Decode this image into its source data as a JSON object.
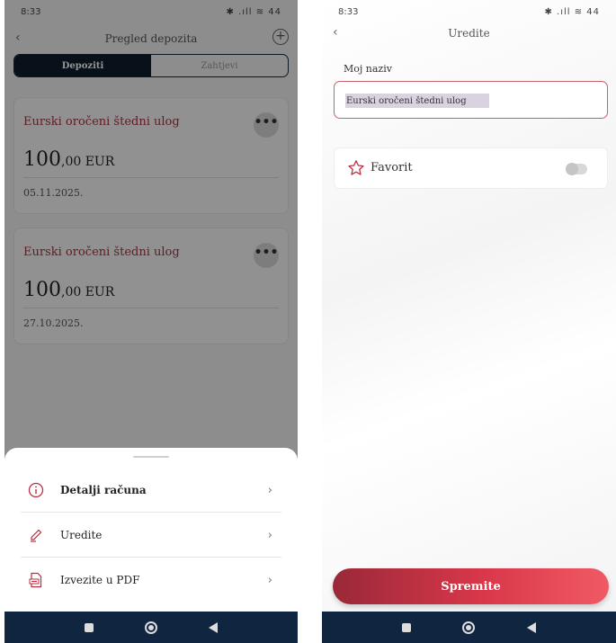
{
  "status_bar": {
    "time": "8:33",
    "indicators": "✦ ▮ ⬆ ▸",
    "right": "✱ .ıll ≋ 44"
  },
  "left_screen": {
    "header": {
      "back_icon": "chevron-left-icon",
      "title": "Pregled depozita",
      "action_icon": "plus-circle-icon"
    },
    "tabs": [
      {
        "label": "Depoziti",
        "active": true
      },
      {
        "label": "Zahtjevi",
        "active": false
      }
    ],
    "deposits": [
      {
        "name": "Eurski oročeni štedni ulog",
        "amount_int": "100",
        "amount_dec": ",00 EUR",
        "date": "05.11.2025."
      },
      {
        "name": "Eurski oročeni štedni ulog",
        "amount_int": "100",
        "amount_dec": ",00 EUR",
        "date": "27.10.2025."
      }
    ],
    "more_label": "•••",
    "sheet": {
      "items": [
        {
          "label": "Detalji računa",
          "icon": "info-icon"
        },
        {
          "label": "Uredite",
          "icon": "pencil-icon"
        },
        {
          "label": "Izvezite u PDF",
          "icon": "pdf-icon"
        }
      ],
      "chevron": "›"
    }
  },
  "right_screen": {
    "header": {
      "back_icon": "chevron-left-icon",
      "title": "Uredite"
    },
    "name_field": {
      "label": "Moj naziv",
      "value": "Eurski oročeni štedni ulog"
    },
    "favorite": {
      "label": "Favorit",
      "icon": "star-icon",
      "enabled": false
    },
    "save_button": "Spremite"
  },
  "colors": {
    "brand_red": "#c0303f",
    "navy": "#0f2540",
    "tab_active": "#0f1e2e"
  }
}
